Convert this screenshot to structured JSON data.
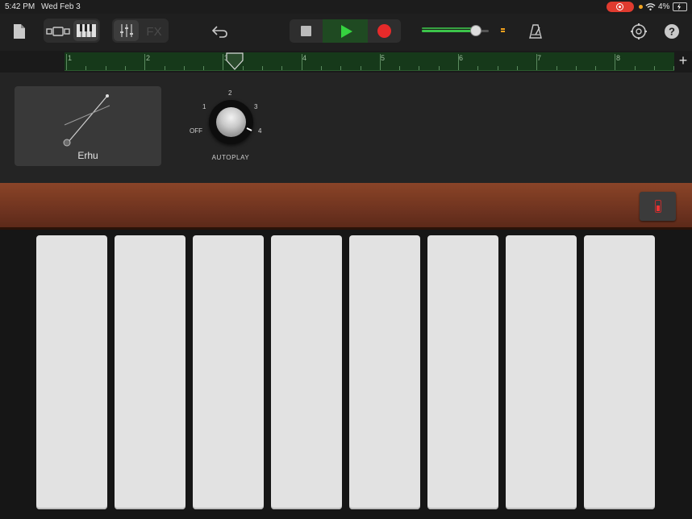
{
  "status_bar": {
    "time": "5:42 PM",
    "date": "Wed Feb 3",
    "battery_percent": "4%"
  },
  "toolbar": {
    "fx_label": "FX"
  },
  "ruler": {
    "bars": [
      "1",
      "2",
      "3",
      "4",
      "5",
      "6",
      "7",
      "8"
    ]
  },
  "instrument": {
    "name": "Erhu"
  },
  "autoplay": {
    "label": "AUTOPLAY",
    "positions": [
      "OFF",
      "1",
      "2",
      "3",
      "4"
    ]
  },
  "colors": {
    "play_green": "#35d43f",
    "record_red": "#e62a2a",
    "ruler_green": "#16391a",
    "wood": "#7a3a22"
  },
  "keys_count": 8
}
